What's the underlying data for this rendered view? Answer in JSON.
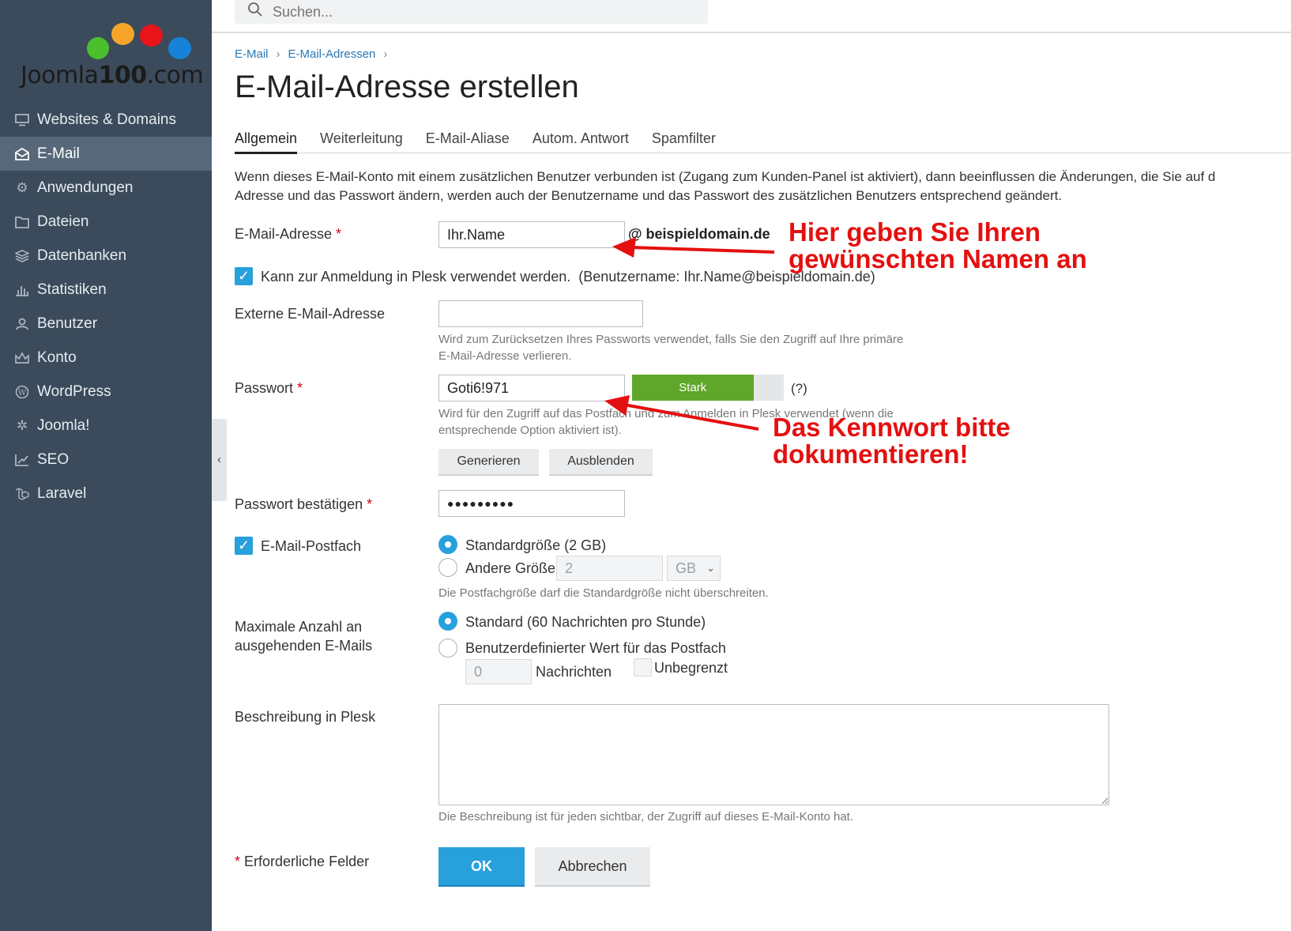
{
  "brand": {
    "logo_text_a": "Joomla",
    "logo_text_b": "100",
    "logo_text_c": ".com"
  },
  "search": {
    "placeholder": "Suchen..."
  },
  "sidebar": {
    "items": [
      {
        "label": "Websites & Domains",
        "icon": "monitor-icon"
      },
      {
        "label": "E-Mail",
        "icon": "mail-icon"
      },
      {
        "label": "Anwendungen",
        "icon": "gear-icon"
      },
      {
        "label": "Dateien",
        "icon": "folder-icon"
      },
      {
        "label": "Datenbanken",
        "icon": "database-icon"
      },
      {
        "label": "Statistiken",
        "icon": "chart-icon"
      },
      {
        "label": "Benutzer",
        "icon": "user-icon"
      },
      {
        "label": "Konto",
        "icon": "crown-icon"
      },
      {
        "label": "WordPress",
        "icon": "wordpress-icon"
      },
      {
        "label": "Joomla!",
        "icon": "joomla-icon"
      },
      {
        "label": "SEO",
        "icon": "seo-icon"
      },
      {
        "label": "Laravel",
        "icon": "laravel-icon"
      }
    ],
    "active": "E-Mail"
  },
  "breadcrumb": {
    "item1": "E-Mail",
    "item2": "E-Mail-Adressen"
  },
  "page_title": "E-Mail-Adresse erstellen",
  "tabs": [
    "Allgemein",
    "Weiterleitung",
    "E-Mail-Aliase",
    "Autom. Antwort",
    "Spamfilter"
  ],
  "intro": {
    "line1": "Wenn dieses E-Mail-Konto mit einem zusätzlichen Benutzer verbunden ist (Zugang zum Kunden-Panel ist aktiviert), dann beeinflussen die Änderungen, die Sie auf d",
    "line2": "Adresse und das Passwort ändern, werden auch der Benutzername und das Passwort des zusätzlichen Benutzers entsprechend geändert."
  },
  "form": {
    "email_label": "E-Mail-Adresse",
    "email_value": "Ihr.Name",
    "domain_suffix": "@ beispieldomain.de",
    "login_checkbox_label": "Kann zur Anmeldung in Plesk verwendet werden.",
    "login_username_note": "(Benutzername: Ihr.Name@beispieldomain.de)",
    "external_label": "Externe E-Mail-Adresse",
    "external_value": "",
    "external_hint_1": "Wird zum Zurücksetzen Ihres Passworts verwendet, falls Sie den Zugriff auf Ihre primäre",
    "external_hint_2": "E-Mail-Adresse verlieren.",
    "password_label": "Passwort",
    "password_value": "Goti6!971",
    "strength_label": "Stark",
    "strength_level": 0.8,
    "help_link": "(?)",
    "password_hint_1": "Wird für den Zugriff auf das Postfach und zum Anmelden in Plesk verwendet (wenn die",
    "password_hint_2": "entsprechende Option aktiviert ist).",
    "generate_button": "Generieren",
    "hide_button": "Ausblenden",
    "confirm_label": "Passwort bestätigen",
    "confirm_value": "●●●●●●●●●",
    "mailbox_label": "E-Mail-Postfach",
    "mailbox_default": "Standardgröße (2 GB)",
    "mailbox_other": "Andere Größe",
    "mailbox_other_value": "2",
    "mailbox_unit": "GB",
    "mailbox_hint": "Die Postfachgröße darf die Standardgröße nicht überschreiten.",
    "max_label_1": "Maximale Anzahl an",
    "max_label_2": "ausgehenden E-Mails",
    "max_default": "Standard (60 Nachrichten pro Stunde)",
    "max_custom": "Benutzerdefinierter Wert für das Postfach",
    "max_custom_value": "0",
    "max_unit": "Nachrichten",
    "unlimited_label": "Unbegrenzt",
    "description_label": "Beschreibung in Plesk",
    "description_value": "",
    "description_hint": "Die Beschreibung ist für jeden sichtbar, der Zugriff auf dieses E-Mail-Konto hat.",
    "required_note": "Erforderliche Felder",
    "required_star": "*",
    "ok_button": "OK",
    "cancel_button": "Abbrechen"
  },
  "annotations": {
    "note1_line1": "Hier geben Sie Ihren",
    "note1_line2": "gewünschten Namen an",
    "note2_line1": "Das Kennwort bitte",
    "note2_line2": "dokumentieren!"
  },
  "colors": {
    "sidebar_bg": "#3b4b5b",
    "sidebar_active": "#56687a",
    "accent": "#28a0dc",
    "strength": "#5fa72a",
    "annotation": "#e4100f",
    "required": "#d0021b"
  }
}
